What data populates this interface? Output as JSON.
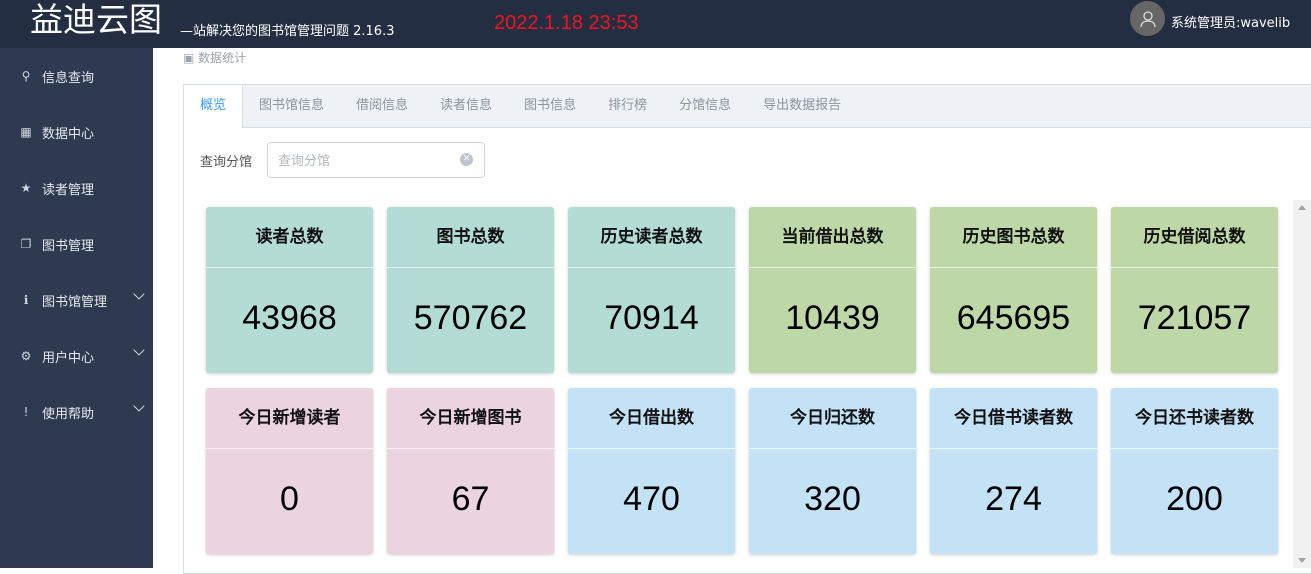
{
  "header": {
    "logo": "益迪云图",
    "slogan": "—站解决您的图书馆管理问题 2.16.3",
    "datetime": "2022.1.18  23:53",
    "user": "系统管理员:wavelib"
  },
  "sidebar": {
    "items": [
      {
        "label": "信息查询",
        "icon": "search-icon",
        "ch": "⚲",
        "expand": false
      },
      {
        "label": "数据中心",
        "icon": "dashboard-icon",
        "ch": "▦",
        "expand": false
      },
      {
        "label": "读者管理",
        "icon": "star-icon",
        "ch": "★",
        "expand": false
      },
      {
        "label": "图书管理",
        "icon": "copy-icon",
        "ch": "❐",
        "expand": false
      },
      {
        "label": "图书馆管理",
        "icon": "info-icon",
        "ch": "ℹ",
        "expand": true
      },
      {
        "label": "用户中心",
        "icon": "gear-icon",
        "ch": "⚙",
        "expand": true
      },
      {
        "label": "使用帮助",
        "icon": "warning-icon",
        "ch": "!",
        "expand": true
      }
    ]
  },
  "breadcrumb": "数据统计",
  "tabs": [
    "概览",
    "图书馆信息",
    "借阅信息",
    "读者信息",
    "图书信息",
    "排行榜",
    "分馆信息",
    "导出数据报告"
  ],
  "search": {
    "label": "查询分馆",
    "placeholder": "查询分馆"
  },
  "colors": {
    "teal": "#b3dcd5",
    "green": "#bed7a6",
    "pink": "#ebd3e0",
    "blue": "#c3e2f5"
  },
  "stats": [
    {
      "title": "读者总数",
      "value": "43968",
      "color": "teal"
    },
    {
      "title": "图书总数",
      "value": "570762",
      "color": "teal"
    },
    {
      "title": "历史读者总数",
      "value": "70914",
      "color": "teal"
    },
    {
      "title": "当前借出总数",
      "value": "10439",
      "color": "green"
    },
    {
      "title": "历史图书总数",
      "value": "645695",
      "color": "green"
    },
    {
      "title": "历史借阅总数",
      "value": "721057",
      "color": "green"
    },
    {
      "title": "今日新增读者",
      "value": "0",
      "color": "pink"
    },
    {
      "title": "今日新增图书",
      "value": "67",
      "color": "pink"
    },
    {
      "title": "今日借出数",
      "value": "470",
      "color": "blue"
    },
    {
      "title": "今日归还数",
      "value": "320",
      "color": "blue"
    },
    {
      "title": "今日借书读者数",
      "value": "274",
      "color": "blue"
    },
    {
      "title": "今日还书读者数",
      "value": "200",
      "color": "blue"
    }
  ]
}
